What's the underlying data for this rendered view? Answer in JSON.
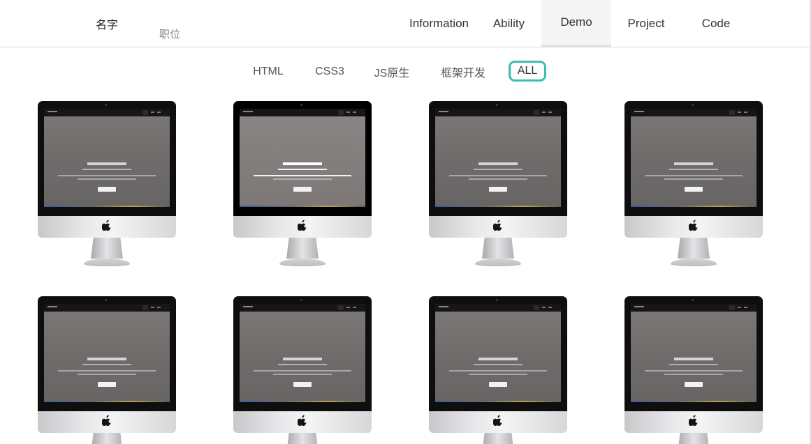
{
  "header": {
    "name": "名字",
    "title": "职位",
    "nav": [
      {
        "label": "Information",
        "active": false
      },
      {
        "label": "Ability",
        "active": false
      },
      {
        "label": "Demo",
        "active": true
      },
      {
        "label": "Project",
        "active": false
      },
      {
        "label": "Code",
        "active": false
      }
    ]
  },
  "filters": [
    {
      "label": "HTML",
      "active": false
    },
    {
      "label": "CSS3",
      "active": false
    },
    {
      "label": "JS原生",
      "active": false
    },
    {
      "label": "框架开发",
      "active": false
    },
    {
      "label": "ALL",
      "active": true
    }
  ],
  "demos": {
    "preview_heading": "基于bootstrap开发的网站",
    "preview_button": "进入bootstrap官网",
    "count": 8,
    "hovered_index": 1
  },
  "colors": {
    "accent": "#3bbdb2",
    "nav_active_bg": "#f5f5f5",
    "divider": "#d8d8d8"
  },
  "icons": {
    "device": "imac-icon",
    "logo": "apple-logo-icon"
  }
}
